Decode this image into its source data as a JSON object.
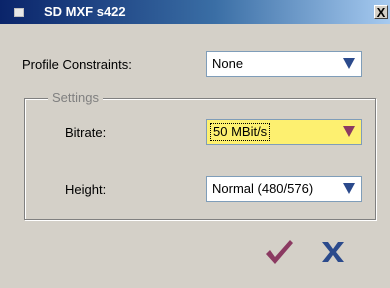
{
  "window": {
    "title": "SD MXF s422",
    "close_glyph": "X"
  },
  "form": {
    "profile_constraints": {
      "label": "Profile Constraints:",
      "value": "None"
    },
    "settings_group": {
      "legend": "Settings",
      "bitrate": {
        "label": "Bitrate:",
        "value": "50 MBit/s"
      },
      "height": {
        "label": "Height:",
        "value": "Normal (480/576)"
      }
    }
  },
  "buttons": {
    "ok_icon": "checkmark-icon",
    "cancel_icon": "x-icon"
  },
  "colors": {
    "title_gradient_start": "#0a246a",
    "title_gradient_end": "#a6caf0",
    "face": "#d4d0c8",
    "focus_highlight": "#fdf070",
    "ok_accent": "#8b3a62",
    "cancel_accent": "#2b4a8c"
  }
}
